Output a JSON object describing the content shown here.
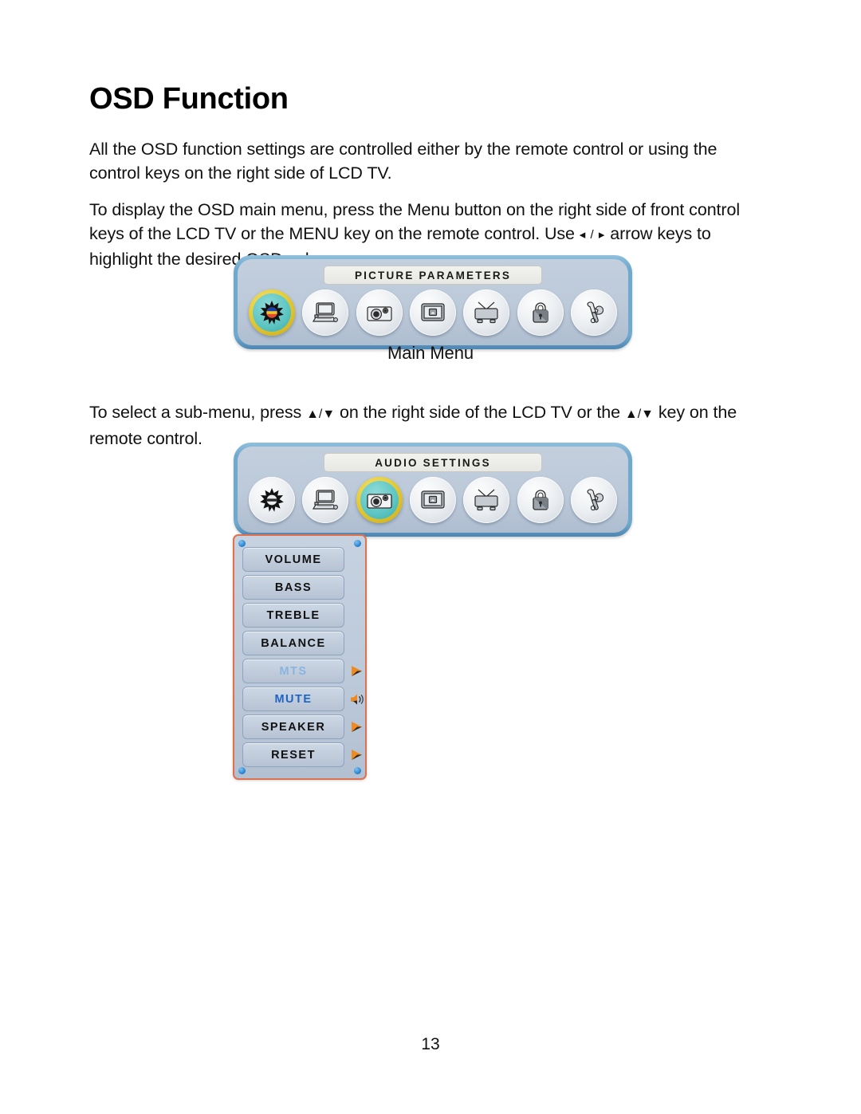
{
  "document": {
    "title": "OSD Function",
    "page_number": "13"
  },
  "paragraphs": {
    "p1": "All the OSD function settings are controlled either by the remote control or using the control keys on the right side of LCD TV.",
    "p2_part1": "To display the OSD main menu, press the Menu button on the right side of front control keys of the LCD TV or the MENU key on the remote control. Use ",
    "p2_arrows": "◂ / ▸",
    "p2_part2": " arrow keys to highlight the desired OSD sub-menu.",
    "p3_part1": "To select a sub-menu, press ",
    "p3_arrows_1": "▲/▼",
    "p3_part2": " on the right side of the LCD TV or the ",
    "p3_arrows_2": "▲/▼",
    "p3_part3": " key on the remote control."
  },
  "captions": {
    "main_menu": "Main Menu"
  },
  "osd_panels": [
    {
      "id": "picture",
      "title": "PICTURE PARAMETERS",
      "selected_index": 0,
      "icons": [
        {
          "name": "picture-color-icon",
          "label": "Picture Parameters"
        },
        {
          "name": "computer-pc-icon",
          "label": "PC Settings"
        },
        {
          "name": "audio-camera-icon",
          "label": "Audio Settings"
        },
        {
          "name": "screen-osd-icon",
          "label": "OSD Settings"
        },
        {
          "name": "tv-channel-icon",
          "label": "Channel Settings"
        },
        {
          "name": "lock-parental-icon",
          "label": "Parental Lock"
        },
        {
          "name": "tools-setup-icon",
          "label": "Setup"
        }
      ]
    },
    {
      "id": "audio",
      "title": "AUDIO SETTINGS",
      "selected_index": 2,
      "icons": [
        {
          "name": "picture-color-icon",
          "label": "Picture Parameters"
        },
        {
          "name": "computer-pc-icon",
          "label": "PC Settings"
        },
        {
          "name": "audio-camera-icon",
          "label": "Audio Settings"
        },
        {
          "name": "screen-osd-icon",
          "label": "OSD Settings"
        },
        {
          "name": "tv-channel-icon",
          "label": "Channel Settings"
        },
        {
          "name": "lock-parental-icon",
          "label": "Parental Lock"
        },
        {
          "name": "tools-setup-icon",
          "label": "Setup"
        }
      ]
    }
  ],
  "audio_submenu": {
    "items": [
      {
        "label": "VOLUME",
        "state": "normal",
        "indicator": "none"
      },
      {
        "label": "BASS",
        "state": "normal",
        "indicator": "none"
      },
      {
        "label": "TREBLE",
        "state": "normal",
        "indicator": "none"
      },
      {
        "label": "BALANCE",
        "state": "normal",
        "indicator": "none"
      },
      {
        "label": "MTS",
        "state": "dim",
        "indicator": "arrow"
      },
      {
        "label": "MUTE",
        "state": "active",
        "indicator": "speaker"
      },
      {
        "label": "SPEAKER",
        "state": "normal",
        "indicator": "arrow"
      },
      {
        "label": "RESET",
        "state": "normal",
        "indicator": "arrow"
      }
    ]
  },
  "colors": {
    "panel_border_blue": "#6fa9cd",
    "panel_fill": "#bcc9d9",
    "submenu_border": "#e1714e",
    "selected_ring": "#e8cf3c",
    "selected_fill": "#5cc5c2",
    "indicator_orange": "#f08a1e",
    "label_dim": "#8ab4e0",
    "label_active": "#1f63c4"
  }
}
